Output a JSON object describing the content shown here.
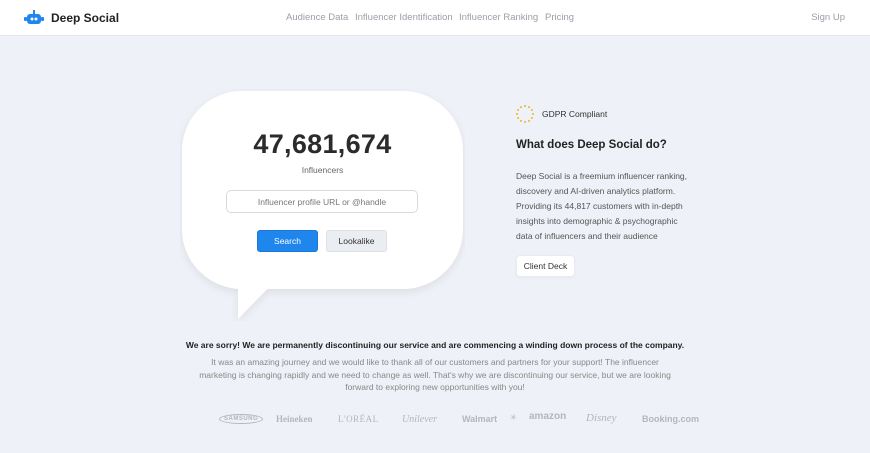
{
  "header": {
    "brand": "Deep Social",
    "nav": [
      "Audience Data",
      "Influencer Identification",
      "Influencer Ranking",
      "Pricing"
    ],
    "signup": "Sign Up"
  },
  "hero": {
    "count": "47,681,674",
    "count_label": "Influencers",
    "search_placeholder": "Influencer profile URL or @handle",
    "search_button": "Search",
    "lookalike_button": "Lookalike"
  },
  "info": {
    "gdpr": "GDPR Compliant",
    "title": "What does Deep Social do?",
    "description": "Deep Social is a freemium influencer ranking, discovery and AI-driven analytics platform. Providing its 44,817 customers with in-depth insights into demographic & psychographic data of influencers and their audience",
    "client_deck": "Client Deck"
  },
  "notice": {
    "title": "We are sorry! We are permanently discontinuing our service and are commencing a winding down process of the company.",
    "body": "It was an amazing journey and we would like to thank all of our customers and partners for your support! The influencer marketing is changing rapidly and we need to change as well. That's why we are discontinuing our service, but we are looking forward to exploring new opportunities with you!"
  },
  "logos": [
    "SAMSUNG",
    "Heineken",
    "L'ORÉAL",
    "Unilever",
    "Walmart",
    "amazon",
    "Disney",
    "Booking.com"
  ],
  "colors": {
    "accent": "#1f86ee",
    "background": "#eef1f7",
    "gdpr_star": "#f0b429"
  }
}
